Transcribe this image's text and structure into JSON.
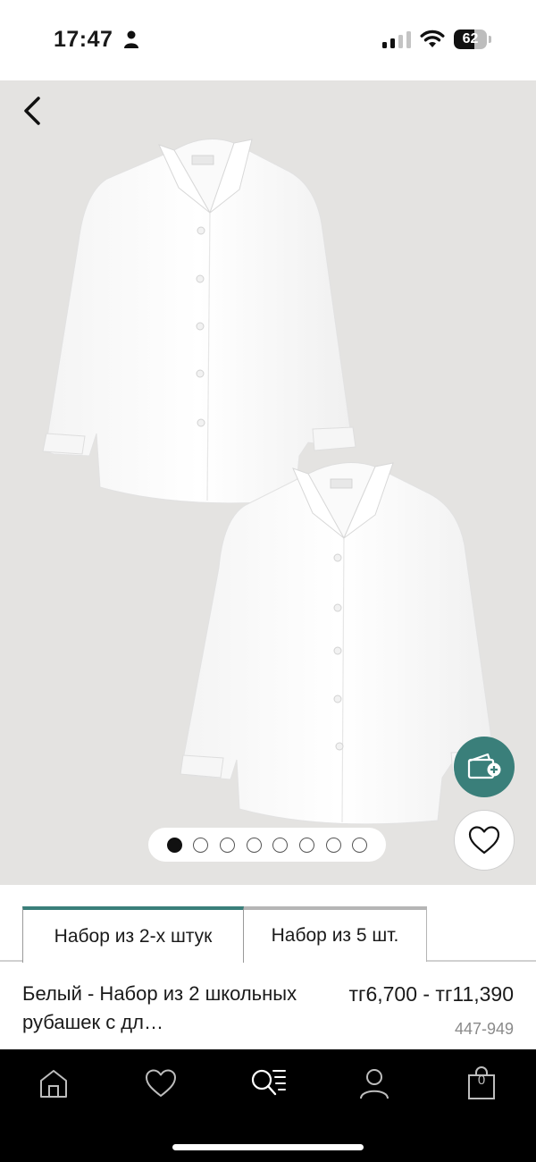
{
  "status_bar": {
    "time": "17:47",
    "battery_level": "62",
    "battery_fraction": 0.62
  },
  "product_gallery": {
    "image_description_icon": "shirt-illustration",
    "page_count": 8,
    "active_page": 1
  },
  "tabs": [
    {
      "label": "Набор из 2-х штук",
      "active": true
    },
    {
      "label": "Набор из 5 шт.",
      "active": false
    }
  ],
  "product": {
    "title": "Белый - Набор из 2 школьных рубашек с дл…",
    "price": "тг6,700 - тг11,390",
    "code": "447-949"
  },
  "bottom_nav": {
    "items": [
      "home-icon",
      "heart-icon",
      "search-icon",
      "account-icon",
      "bag-icon"
    ],
    "bag_count": "0"
  },
  "colors": {
    "accent": "#3a7f7a",
    "image_background": "#e4e3e1",
    "nav_background": "#000000"
  }
}
